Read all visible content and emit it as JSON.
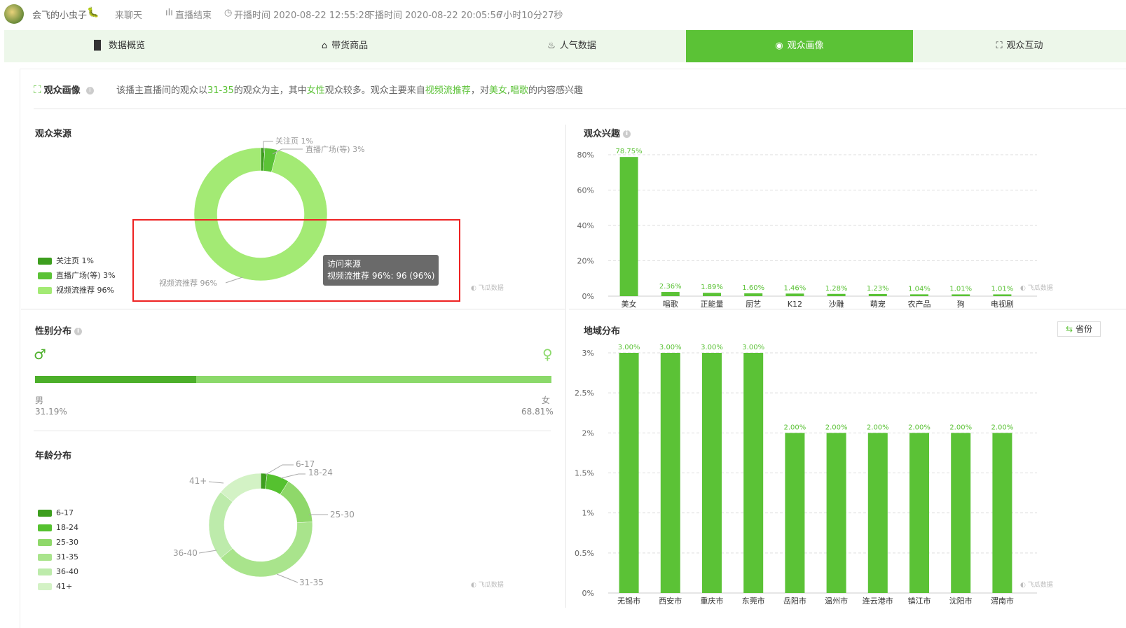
{
  "header": {
    "streamer_name": "会飞的小虫子",
    "category": "来聊天",
    "status": "直播结束",
    "start_time": "开播时间 2020-08-22 12:55:28",
    "end_time": "下播时间 2020-08-22 20:05:56",
    "duration": "7小时10分27秒"
  },
  "tabs": [
    {
      "label": "数据概览",
      "icon": "bar-chart-icon"
    },
    {
      "label": "带货商品",
      "icon": "basket-icon"
    },
    {
      "label": "人气数据",
      "icon": "flame-icon"
    },
    {
      "label": "观众画像",
      "icon": "portrait-icon",
      "active": true
    },
    {
      "label": "观众互动",
      "icon": "interaction-icon"
    }
  ],
  "summary": {
    "title": "观众画像",
    "p1": "该播主直播间的观众以",
    "age": "31-35",
    "p2": "的观众为主，其中",
    "gender": "女性",
    "p3": "观众较多。观众主要来自",
    "source": "视频流推荐",
    "p4": "，对",
    "int1": "美女",
    "sep": ",",
    "int2": "唱歌",
    "p5": "的内容感兴趣"
  },
  "source_panel": {
    "title": "观众来源",
    "legend": [
      "关注页 1%",
      "直播广场(等) 3%",
      "视频流推荐 96%"
    ],
    "slice_labels": [
      "关注页 1%",
      "直播广场(等) 3%",
      "视频流推荐 96%"
    ],
    "tooltip_title": "访问来源",
    "tooltip_value": "视频流推荐 96%: 96 (96%)"
  },
  "gender_panel": {
    "title": "性别分布",
    "male_label": "男",
    "male_value": "31.19%",
    "female_label": "女",
    "female_value": "68.81%"
  },
  "age_panel": {
    "title": "年龄分布",
    "legend": [
      "6-17",
      "18-24",
      "25-30",
      "31-35",
      "36-40",
      "41+"
    ]
  },
  "interest_panel": {
    "title": "观众兴趣"
  },
  "region_panel": {
    "title": "地域分布",
    "toggle_label": "省份"
  },
  "watermark": "飞瓜数据",
  "colors": {
    "accent": "#5bc236",
    "source": [
      "#3d9e1e",
      "#5bc236",
      "#a3ea74"
    ],
    "age": [
      "#3d9e1e",
      "#55c12f",
      "#8fd86a",
      "#a9e48c",
      "#bdebab",
      "#d3f2c5"
    ]
  },
  "chart_data": [
    {
      "type": "pie",
      "name": "观众来源",
      "categories": [
        "关注页",
        "直播广场(等)",
        "视频流推荐"
      ],
      "values": [
        1,
        3,
        96
      ]
    },
    {
      "type": "bar",
      "name": "性别分布",
      "categories": [
        "男",
        "女"
      ],
      "values": [
        31.19,
        68.81
      ]
    },
    {
      "type": "pie",
      "name": "年龄分布",
      "categories": [
        "6-17",
        "18-24",
        "25-30",
        "31-35",
        "36-40",
        "41+"
      ],
      "values": [
        2,
        7,
        15,
        40,
        22,
        14
      ]
    },
    {
      "type": "bar",
      "name": "观众兴趣",
      "categories": [
        "美女",
        "唱歌",
        "正能量",
        "厨艺",
        "K12",
        "沙雕",
        "萌宠",
        "农产品",
        "狗",
        "电视剧"
      ],
      "values": [
        78.75,
        2.36,
        1.89,
        1.6,
        1.46,
        1.28,
        1.23,
        1.04,
        1.01,
        1.01
      ],
      "data_labels": [
        "78.75%",
        "2.36%",
        "1.89%",
        "1.60%",
        "1.46%",
        "1.28%",
        "1.23%",
        "1.04%",
        "1.01%",
        "1.01%"
      ],
      "ylim": [
        0,
        80
      ],
      "yticks": [
        "0%",
        "20%",
        "40%",
        "60%",
        "80%"
      ]
    },
    {
      "type": "bar",
      "name": "地域分布",
      "categories": [
        "无锡市",
        "西安市",
        "重庆市",
        "东莞市",
        "岳阳市",
        "温州市",
        "连云港市",
        "镇江市",
        "沈阳市",
        "渭南市"
      ],
      "values": [
        3.0,
        3.0,
        3.0,
        3.0,
        2.0,
        2.0,
        2.0,
        2.0,
        2.0,
        2.0
      ],
      "data_labels": [
        "3.00%",
        "3.00%",
        "3.00%",
        "3.00%",
        "2.00%",
        "2.00%",
        "2.00%",
        "2.00%",
        "2.00%",
        "2.00%"
      ],
      "ylim": [
        0,
        3
      ],
      "yticks": [
        "0%",
        "0.5%",
        "1%",
        "1.5%",
        "2%",
        "2.5%",
        "3%"
      ]
    }
  ]
}
